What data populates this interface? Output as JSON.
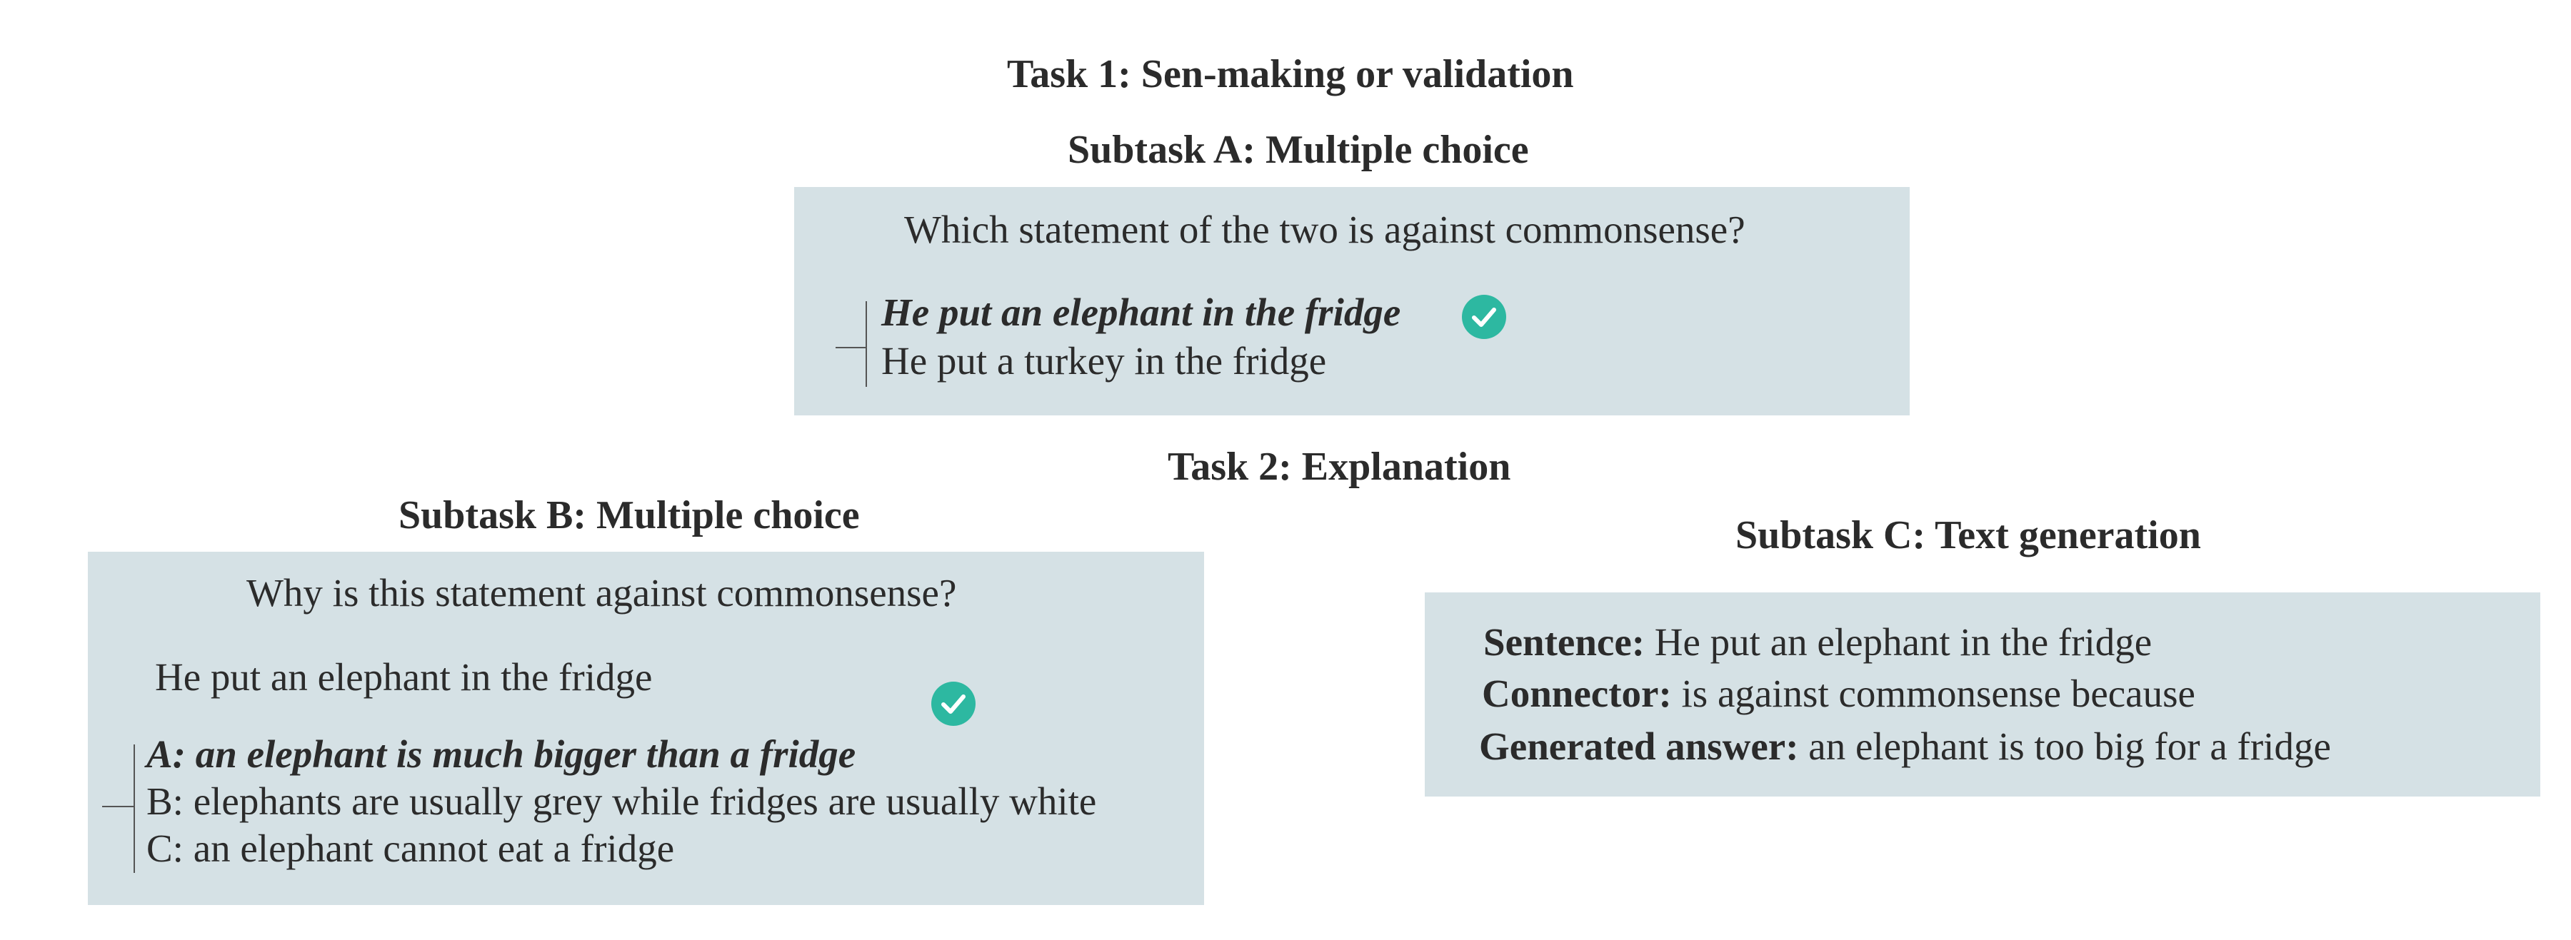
{
  "task1": {
    "title": "Task 1: Sen-making or validation",
    "subtaskA": {
      "title": "Subtask A: Multiple choice",
      "question": "Which statement of the two is against commonsense?",
      "options": [
        "He put an elephant in the fridge",
        "He put a turkey in the fridge"
      ],
      "correct_index": 0
    }
  },
  "task2": {
    "title": "Task 2: Explanation",
    "subtaskB": {
      "title": "Subtask B: Multiple choice",
      "question": "Why is this statement against commonsense?",
      "statement": "He put an elephant in the fridge",
      "options": [
        "A: an elephant is much bigger than a fridge",
        "B: elephants are usually grey while fridges are usually white",
        "C: an elephant cannot eat a fridge"
      ],
      "correct_index": 0
    },
    "subtaskC": {
      "title": "Subtask C: Text generation",
      "sentence_label": "Sentence:",
      "sentence_value": " He put an elephant in the fridge",
      "connector_label": "Connector:",
      "connector_value": " is against commonsense because",
      "answer_label": "Generated answer:",
      "answer_value": " an elephant is too big for a fridge"
    }
  },
  "colors": {
    "box": "#d5e1e5",
    "check": "#2db8a1",
    "text": "#2b2b2b"
  },
  "icons": {
    "correct": "check-circle-icon"
  }
}
